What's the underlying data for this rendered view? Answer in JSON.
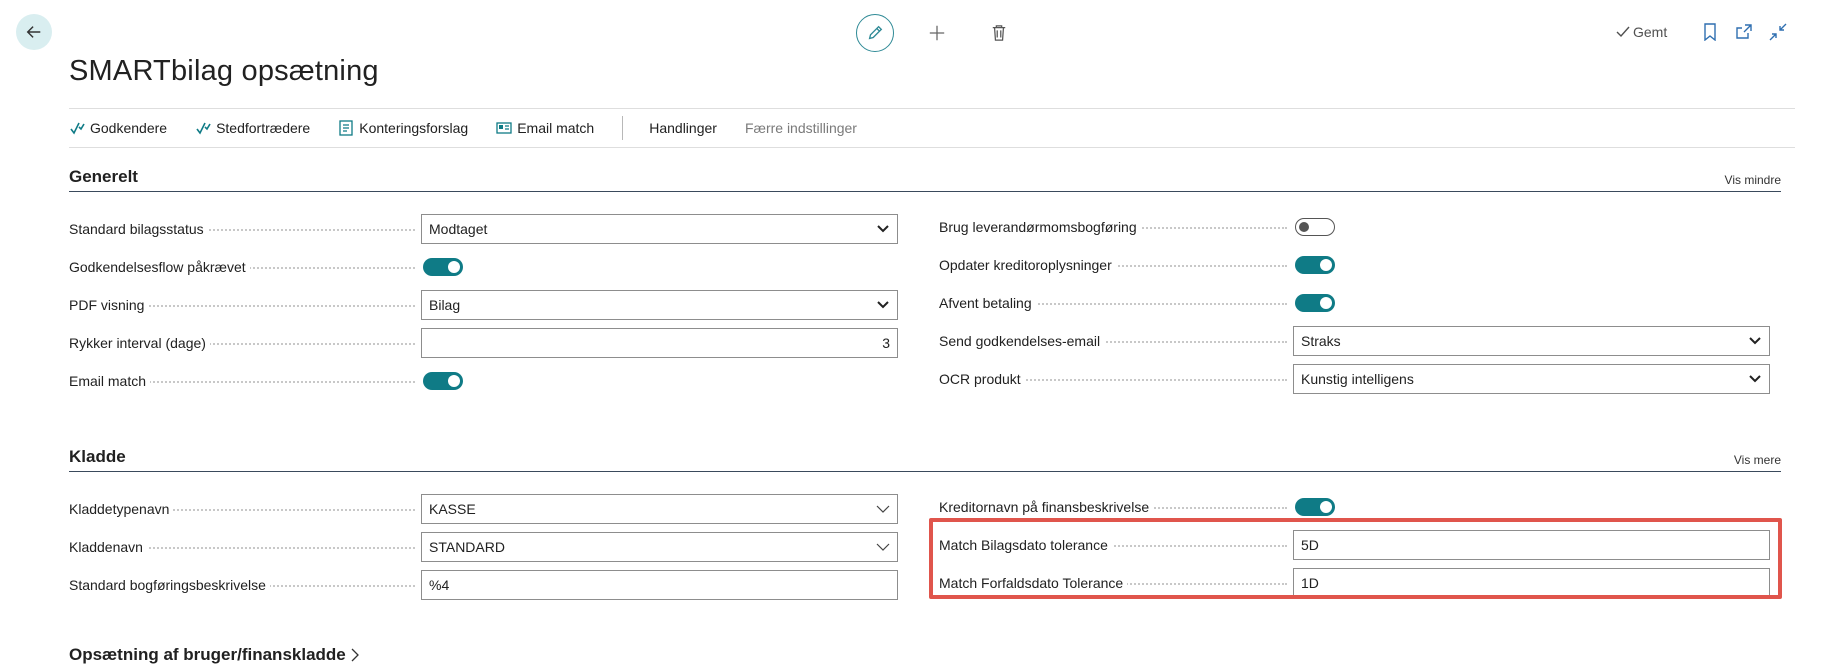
{
  "header": {
    "saved_label": "Gemt",
    "page_title": "SMARTbilag opsætning"
  },
  "actions": [
    {
      "label": "Godkendere",
      "icon": "approvers-icon"
    },
    {
      "label": "Stedfortrædere",
      "icon": "substitutes-icon"
    },
    {
      "label": "Konteringsforslag",
      "icon": "posting-suggestion-icon"
    },
    {
      "label": "Email match",
      "icon": "email-match-icon"
    },
    {
      "label": "Handlinger"
    },
    {
      "label": "Færre indstillinger"
    }
  ],
  "general": {
    "title": "Generelt",
    "toggle_label": "Vis mindre",
    "left": [
      {
        "label": "Standard bilagsstatus",
        "type": "select",
        "value": "Modtaget"
      },
      {
        "label": "Godkendelsesflow påkrævet",
        "type": "toggle",
        "value": "on"
      },
      {
        "label": "PDF visning",
        "type": "select",
        "value": "Bilag"
      },
      {
        "label": "Rykker interval (dage)",
        "type": "number",
        "value": "3"
      },
      {
        "label": "Email match",
        "type": "toggle",
        "value": "on"
      }
    ],
    "right": [
      {
        "label": "Brug leverandørmomsbogføring",
        "type": "toggle",
        "value": "off"
      },
      {
        "label": "Opdater kreditoroplysninger",
        "type": "toggle",
        "value": "on"
      },
      {
        "label": "Afvent betaling",
        "type": "toggle",
        "value": "on"
      },
      {
        "label": "Send godkendelses-email",
        "type": "select",
        "value": "Straks"
      },
      {
        "label": "OCR produkt",
        "type": "select",
        "value": "Kunstig intelligens"
      }
    ]
  },
  "journal": {
    "title": "Kladde",
    "toggle_label": "Vis mere",
    "left": [
      {
        "label": "Kladdetypenavn",
        "type": "lookup",
        "value": "KASSE"
      },
      {
        "label": "Kladdenavn",
        "type": "lookup",
        "value": "STANDARD"
      },
      {
        "label": "Standard bogføringsbeskrivelse",
        "type": "text",
        "value": "%4"
      }
    ],
    "right": [
      {
        "label": "Kreditornavn på finansbeskrivelse",
        "type": "toggle",
        "value": "on"
      },
      {
        "label": "Match Bilagsdato tolerance",
        "type": "text",
        "value": "5D"
      },
      {
        "label": "Match Forfaldsdato Tolerance",
        "type": "text",
        "value": "1D"
      }
    ]
  },
  "footer_section": {
    "title": "Opsætning af bruger/finanskladde"
  },
  "colors": {
    "accent": "#0f7b86",
    "highlight": "#e0554c"
  }
}
